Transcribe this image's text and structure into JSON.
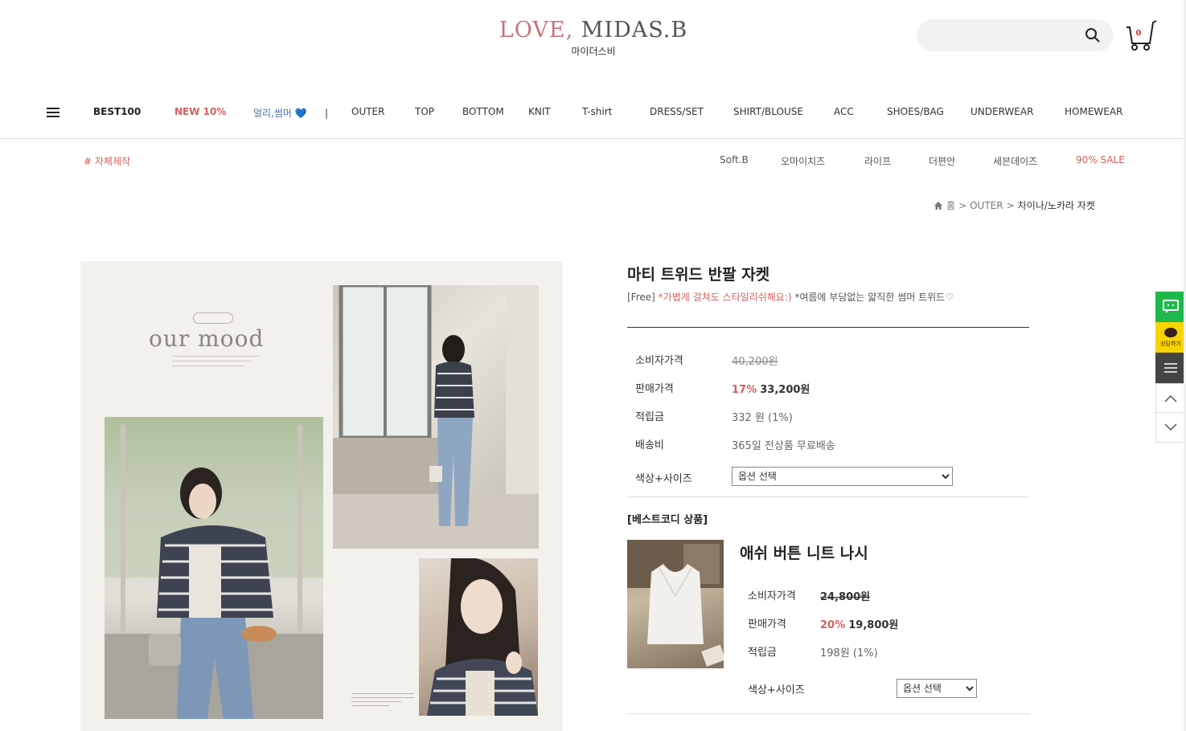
{
  "header": {
    "logo_love": "LOVE,",
    "logo_brand": "MIDAS.B",
    "logo_sub": "마이더스비",
    "search_placeholder": "",
    "cart_count": "0"
  },
  "main_nav": {
    "items": [
      {
        "label": "BEST100"
      },
      {
        "label": "NEW 10%"
      },
      {
        "label": "얼리,썸머 💙"
      },
      {
        "label": "|"
      },
      {
        "label": "OUTER"
      },
      {
        "label": "TOP"
      },
      {
        "label": "BOTTOM"
      },
      {
        "label": "KNIT"
      },
      {
        "label": "T-shirt"
      },
      {
        "label": "DRESS/SET"
      },
      {
        "label": "SHIRT/BLOUSE"
      },
      {
        "label": "ACC"
      },
      {
        "label": "SHOES/BAG"
      },
      {
        "label": "UNDERWEAR"
      },
      {
        "label": "HOMEWEAR"
      }
    ]
  },
  "sub_nav": {
    "left": "# 자체제작",
    "items": [
      {
        "label": "Soft.B"
      },
      {
        "label": "오마이치즈"
      },
      {
        "label": "라이프"
      },
      {
        "label": "더편안"
      },
      {
        "label": "세븐데이즈"
      },
      {
        "label": "90% SALE"
      }
    ]
  },
  "breadcrumb": {
    "home": "홈",
    "sep": ">",
    "category": "OUTER",
    "current": "차이나/노카라 자켓"
  },
  "collage": {
    "title": "our mood"
  },
  "product": {
    "title": "마티 트위드 반팔 자켓",
    "desc_prefix": "[Free] ",
    "desc_red": "*가볍게 걸쳐도 스타일리쉬해요:)",
    "desc_rest": " *여름에 부담없는 얇직한 썸머 트위드♡",
    "rows": {
      "consumer_label": "소비자가격",
      "consumer_value": "40,200원",
      "sale_label": "판매가격",
      "sale_discount": "17%",
      "sale_price": "33,200원",
      "points_label": "적립금",
      "points_value": "332 원 (1%)",
      "shipping_label": "배송비",
      "shipping_value": "365일 전상품 무료배송",
      "option_label": "색상+사이즈",
      "option_selected": "옵션 선택"
    }
  },
  "best_codi": {
    "title": "[베스트코디 상품]",
    "name": "애쉬 버튼 니트 나시",
    "consumer_label": "소비자가격",
    "consumer_value": "24,800원",
    "sale_label": "판매가격",
    "sale_discount": "20%",
    "sale_price": "19,800원",
    "points_label": "적립금",
    "points_value": "198원 (1%)",
    "option_label": "색상+사이즈",
    "option_selected": "옵션 선택"
  },
  "quick_menu": {
    "kakao_label": "상담하기"
  },
  "colors": {
    "accent_red": "#d5605f",
    "talk_green": "#1db94a",
    "kakao_yellow": "#f7d400"
  }
}
